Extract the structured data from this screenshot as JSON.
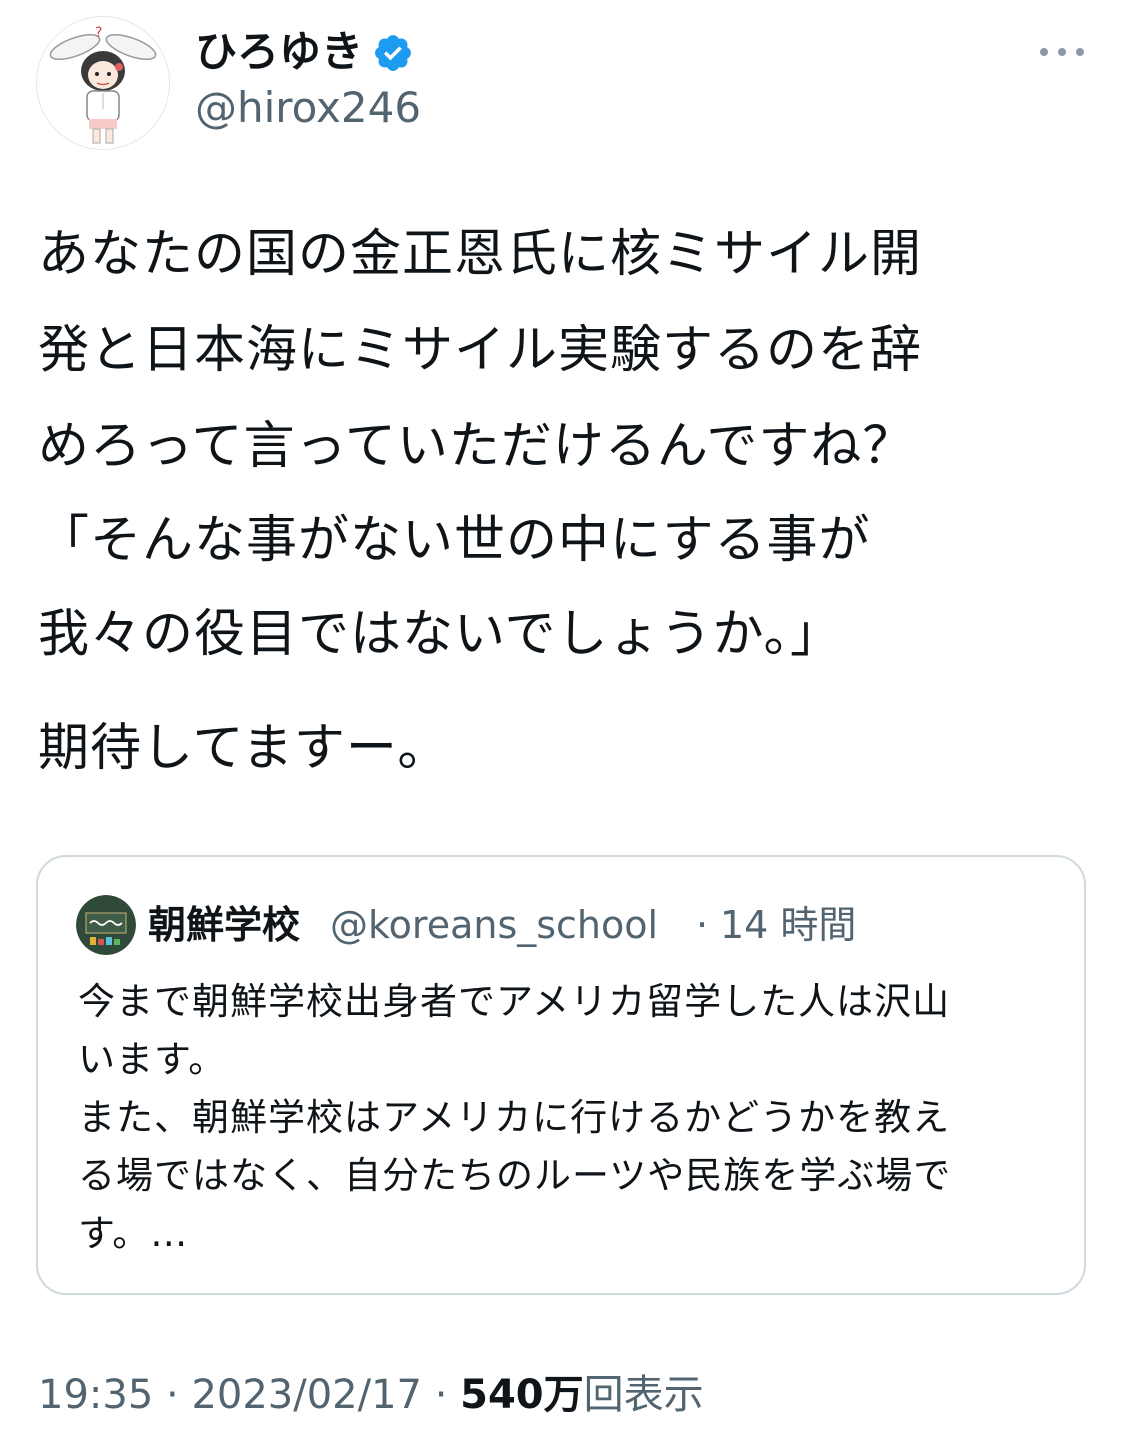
{
  "author": {
    "display_name": "ひろゆき",
    "handle": "@hirox246",
    "verified_icon": "verified-badge-icon",
    "avatar_icon": "bunny-ear-girl-avatar"
  },
  "menu": {
    "more_icon": "more-dots-icon"
  },
  "tweet": {
    "lines": [
      "あなたの国の金正恩氏に核ミサイル開",
      "発と日本海にミサイル実験するのを辞",
      "めろって言っていただけるんですね？",
      "「そんな事がない世の中にする事が",
      "我々の役目ではないでしょうか。」",
      "期待してますー。"
    ]
  },
  "quote": {
    "name": "朝鮮学校",
    "handle": "@koreans_school",
    "separator": "·",
    "time": "14 時間",
    "avatar_icon": "chalkboard-avatar",
    "lines": [
      "今まで朝鮮学校出身者でアメリカ留学した人は沢山",
      "います。",
      "また、朝鮮学校はアメリカに行けるかどうかを教え",
      "る場ではなく、自分たちのルーツや民族を学ぶ場で",
      "す。…"
    ]
  },
  "footer": {
    "time": "19:35",
    "sep1": "·",
    "date": "2023/02/17",
    "sep2": "·",
    "views_count": "540万",
    "views_label": "回表示"
  },
  "colors": {
    "text": "#0f1419",
    "secondary": "#536471",
    "verified": "#1d9bf0",
    "border": "#cfd9de"
  }
}
